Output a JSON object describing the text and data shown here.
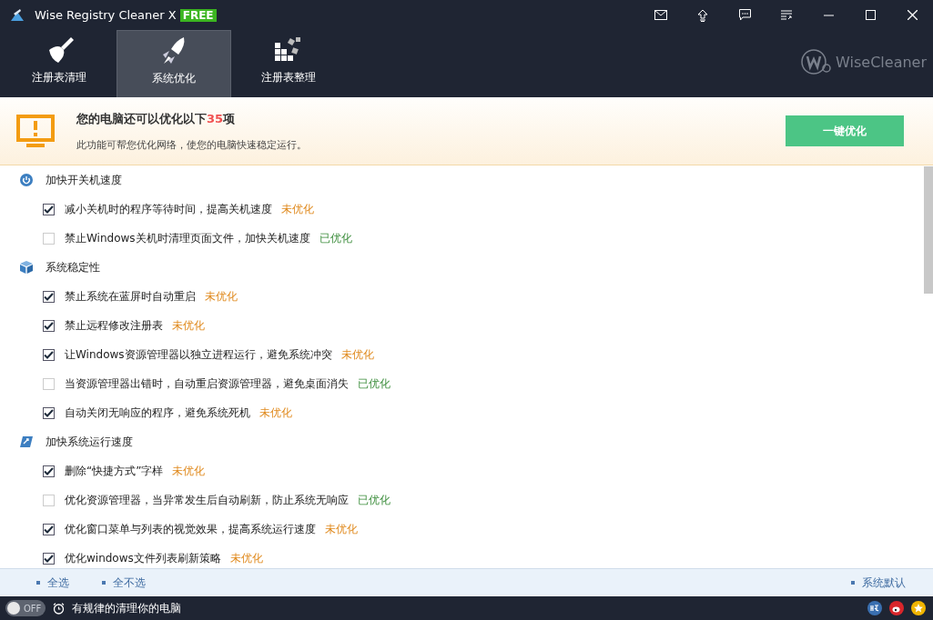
{
  "window": {
    "title": "Wise Registry Cleaner X",
    "badge": "FREE"
  },
  "tabs": [
    {
      "label": "注册表清理",
      "selected": false
    },
    {
      "label": "系统优化",
      "selected": true
    },
    {
      "label": "注册表整理",
      "selected": false
    }
  ],
  "brand": "WiseCleaner",
  "banner": {
    "headline_prefix": "您的电脑还可以优化以下",
    "count": "35",
    "headline_suffix": "项",
    "description": "此功能可帮您优化网络，使您的电脑快速稳定运行。",
    "button": "一键优化"
  },
  "groups": [
    {
      "title": "加快开关机速度",
      "items": [
        {
          "label": "减小关机时的程序等待时间，提高关机速度",
          "checked": true,
          "status": "未优化",
          "optimized": false
        },
        {
          "label": "禁止Windows关机时清理页面文件，加快关机速度",
          "checked": false,
          "status": "已优化",
          "optimized": true
        }
      ]
    },
    {
      "title": "系统稳定性",
      "items": [
        {
          "label": "禁止系统在蓝屏时自动重启",
          "checked": true,
          "status": "未优化",
          "optimized": false
        },
        {
          "label": "禁止远程修改注册表",
          "checked": true,
          "status": "未优化",
          "optimized": false
        },
        {
          "label": "让Windows资源管理器以独立进程运行，避免系统冲突",
          "checked": true,
          "status": "未优化",
          "optimized": false
        },
        {
          "label": "当资源管理器出错时，自动重启资源管理器，避免桌面消失",
          "checked": false,
          "status": "已优化",
          "optimized": true
        },
        {
          "label": "自动关闭无响应的程序，避免系统死机",
          "checked": true,
          "status": "未优化",
          "optimized": false
        }
      ]
    },
    {
      "title": "加快系统运行速度",
      "items": [
        {
          "label": "删除“快捷方式”字样",
          "checked": true,
          "status": "未优化",
          "optimized": false
        },
        {
          "label": "优化资源管理器，当异常发生后自动刷新，防止系统无响应",
          "checked": false,
          "status": "已优化",
          "optimized": true
        },
        {
          "label": "优化窗口菜单与列表的视觉效果，提高系统运行速度",
          "checked": true,
          "status": "未优化",
          "optimized": false
        },
        {
          "label": "优化windows文件列表刷新策略",
          "checked": true,
          "status": "未优化",
          "optimized": false
        }
      ]
    }
  ],
  "footer_links": [
    {
      "label": "全选"
    },
    {
      "label": "全不选"
    }
  ],
  "footer_right": "系统默认",
  "status_bar": {
    "toggle": {
      "label": "OFF",
      "on": false
    },
    "text": "有规律的清理你的电脑"
  }
}
